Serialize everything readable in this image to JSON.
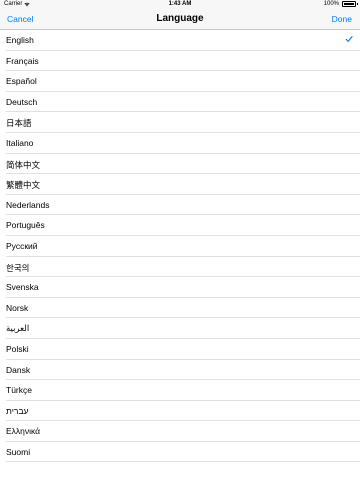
{
  "status_bar": {
    "carrier": "Carrier",
    "time": "1:43 AM",
    "battery_percent": "100%",
    "battery_level": 1.0
  },
  "nav": {
    "cancel_label": "Cancel",
    "title": "Language",
    "done_label": "Done"
  },
  "colors": {
    "accent": "#007aff",
    "separator": "#e0e0e3",
    "bar_bg": "#f7f7f8"
  },
  "languages": [
    {
      "label": "English",
      "selected": true
    },
    {
      "label": "Français",
      "selected": false
    },
    {
      "label": "Español",
      "selected": false
    },
    {
      "label": "Deutsch",
      "selected": false
    },
    {
      "label": "日本語",
      "selected": false
    },
    {
      "label": "Italiano",
      "selected": false
    },
    {
      "label": "简体中文",
      "selected": false
    },
    {
      "label": "繁體中文",
      "selected": false
    },
    {
      "label": "Nederlands",
      "selected": false
    },
    {
      "label": "Português",
      "selected": false
    },
    {
      "label": "Русский",
      "selected": false
    },
    {
      "label": "한국의",
      "selected": false
    },
    {
      "label": "Svenska",
      "selected": false
    },
    {
      "label": "Norsk",
      "selected": false
    },
    {
      "label": "العربية",
      "selected": false
    },
    {
      "label": "Polski",
      "selected": false
    },
    {
      "label": "Dansk",
      "selected": false
    },
    {
      "label": "Türkçe",
      "selected": false
    },
    {
      "label": "עברית",
      "selected": false
    },
    {
      "label": "Ελληνικά",
      "selected": false
    },
    {
      "label": "Suomi",
      "selected": false
    }
  ]
}
